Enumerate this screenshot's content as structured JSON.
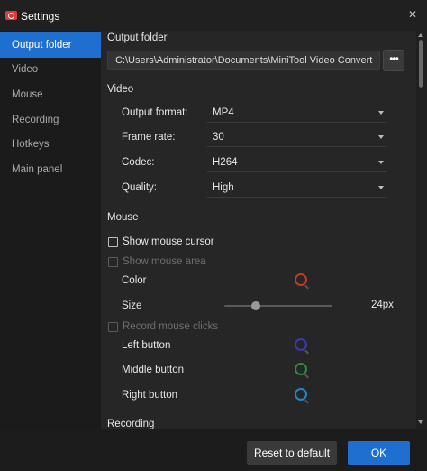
{
  "window": {
    "title": "Settings",
    "close_symbol": "✕"
  },
  "sidebar": {
    "items": [
      {
        "label": "Output folder",
        "active": true
      },
      {
        "label": "Video"
      },
      {
        "label": "Mouse"
      },
      {
        "label": "Recording"
      },
      {
        "label": "Hotkeys"
      },
      {
        "label": "Main panel"
      }
    ]
  },
  "output_folder": {
    "title": "Output folder",
    "path": "C:\\Users\\Administrator\\Documents\\MiniTool Video Convert",
    "browse_symbol": "•••"
  },
  "video": {
    "title": "Video",
    "output_format": {
      "label": "Output format:",
      "value": "MP4"
    },
    "frame_rate": {
      "label": "Frame rate:",
      "value": "30"
    },
    "codec": {
      "label": "Codec:",
      "value": "H264"
    },
    "quality": {
      "label": "Quality:",
      "value": "High"
    }
  },
  "mouse": {
    "title": "Mouse",
    "show_cursor": {
      "label": "Show mouse cursor",
      "checked": false
    },
    "show_area": {
      "label": "Show mouse area",
      "checked": false,
      "disabled": true
    },
    "color_label": "Color",
    "size_label": "Size",
    "size_value": "24px",
    "size_fraction": 0.29,
    "record_clicks": {
      "label": "Record mouse clicks",
      "checked": false,
      "disabled": true
    },
    "left_button": "Left button",
    "middle_button": "Middle button",
    "right_button": "Right button",
    "colors": {
      "area": "#c0392b",
      "left": "#3b3bb0",
      "middle": "#2e8b3e",
      "right": "#1e88c8"
    }
  },
  "recording": {
    "title": "Recording"
  },
  "footer": {
    "reset_label": "Reset to default",
    "ok_label": "OK"
  },
  "theme": {
    "accent": "#1f6fd1",
    "background": "#262626"
  }
}
